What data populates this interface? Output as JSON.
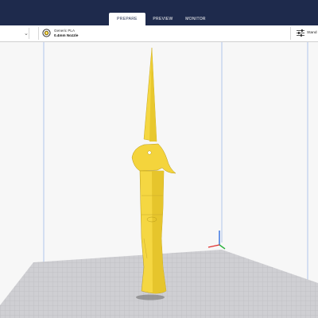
{
  "stage_menu": {
    "tabs": [
      {
        "label": "PREPARE",
        "active": true
      },
      {
        "label": "PREVIEW",
        "active": false
      },
      {
        "label": "MONITOR",
        "active": false
      }
    ]
  },
  "printer_selector": {
    "material": "Generic PLA",
    "nozzle": "0.4mm Nozzle",
    "material_icon": "spool-icon"
  },
  "print_settings": {
    "profile_label": "Stand",
    "icon": "sliders-icon"
  },
  "viewport": {
    "model": "folding knife",
    "model_color": "#f5d742",
    "axis_icons": [
      "x-axis",
      "y-axis",
      "z-axis"
    ]
  },
  "colors": {
    "header_bg": "#1e2a4c",
    "accent_blue": "#2d6de0",
    "build_plate": "#c8c8cc"
  }
}
